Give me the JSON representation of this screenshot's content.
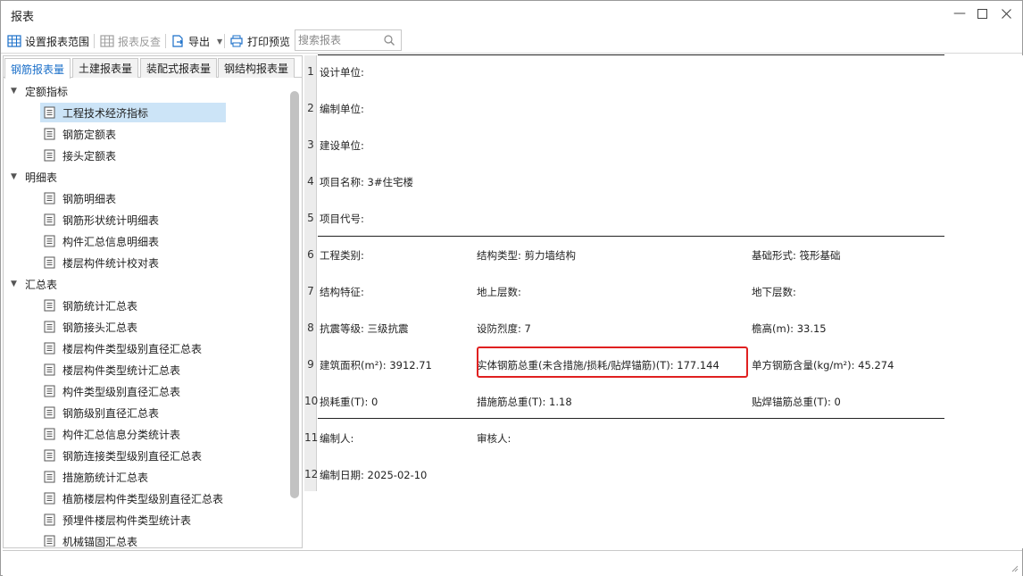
{
  "window": {
    "title": "报表"
  },
  "toolbar": {
    "set_range": "设置报表范围",
    "reverse": "报表反查",
    "export": "导出",
    "print_preview": "打印预览",
    "search_placeholder": "搜索报表"
  },
  "tabs": [
    "钢筋报表量",
    "土建报表量",
    "装配式报表量",
    "钢结构报表量"
  ],
  "tree": {
    "group1": "定额指标",
    "group1_items": [
      "工程技术经济指标",
      "钢筋定额表",
      "接头定额表"
    ],
    "group2": "明细表",
    "group2_items": [
      "钢筋明细表",
      "钢筋形状统计明细表",
      "构件汇总信息明细表",
      "楼层构件统计校对表"
    ],
    "group3": "汇总表",
    "group3_items": [
      "钢筋统计汇总表",
      "钢筋接头汇总表",
      "楼层构件类型级别直径汇总表",
      "楼层构件类型统计汇总表",
      "构件类型级别直径汇总表",
      "钢筋级别直径汇总表",
      "构件汇总信息分类统计表",
      "钢筋连接类型级别直径汇总表",
      "措施筋统计汇总表",
      "植筋楼层构件类型级别直径汇总表",
      "预埋件楼层构件类型统计表",
      "机械锚固汇总表"
    ]
  },
  "report": {
    "row_numbers": [
      "1",
      "2",
      "3",
      "4",
      "5",
      "6",
      "7",
      "8",
      "9",
      "10",
      "11",
      "12"
    ],
    "r1": "设计单位:",
    "r2": "编制单位:",
    "r3": "建设单位:",
    "r4": "项目名称: 3#住宅楼",
    "r5": "项目代号:",
    "r6a": "工程类别:",
    "r6b": "结构类型: 剪力墙结构",
    "r6c": "基础形式: 筏形基础",
    "r7a": "结构特征:",
    "r7b": "地上层数:",
    "r7c": "地下层数:",
    "r8a": "抗震等级: 三级抗震",
    "r8b": "设防烈度: 7",
    "r8c": "檐高(m): 33.15",
    "r9a": "建筑面积(m²): 3912.71",
    "r9b": "实体钢筋总重(未含措施/损耗/贴焊锚筋)(T): 177.144",
    "r9c": "单方钢筋含量(kg/m²): 45.274",
    "r10a": "损耗重(T): 0",
    "r10b": "措施筋总重(T): 1.18",
    "r10c": "贴焊锚筋总重(T): 0",
    "r11a": "编制人:",
    "r11b": "审核人:",
    "r12": "编制日期: 2025-02-10"
  },
  "colors": {
    "accent": "#1a6fc9",
    "highlight": "#e02020",
    "selection": "#cce4f7"
  }
}
